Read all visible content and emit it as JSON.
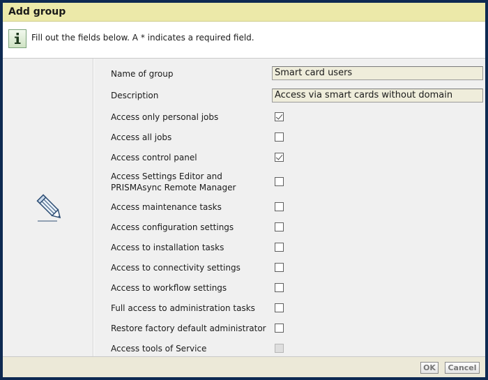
{
  "dialog": {
    "title": "Add group"
  },
  "info": {
    "icon": "info-icon",
    "text": "Fill out the fields below. A * indicates a required field."
  },
  "side": {
    "icon": "pencil-icon"
  },
  "fields": {
    "name": {
      "label": "Name of group",
      "value": "Smart card users"
    },
    "description": {
      "label": "Description",
      "value": "Access via smart cards without domain"
    }
  },
  "permissions": [
    {
      "label": "Access only personal jobs",
      "checked": true,
      "enabled": true
    },
    {
      "label": "Access all jobs",
      "checked": false,
      "enabled": true
    },
    {
      "label": "Access control panel",
      "checked": true,
      "enabled": true
    },
    {
      "label_line1": "Access Settings Editor and",
      "label_line2": "PRISMAsync Remote Manager",
      "checked": false,
      "enabled": true
    },
    {
      "label": "Access maintenance tasks",
      "checked": false,
      "enabled": true
    },
    {
      "label": "Access configuration settings",
      "checked": false,
      "enabled": true
    },
    {
      "label": "Access to installation tasks",
      "checked": false,
      "enabled": true
    },
    {
      "label": "Access to connectivity settings",
      "checked": false,
      "enabled": true
    },
    {
      "label": "Access to workflow settings",
      "checked": false,
      "enabled": true
    },
    {
      "label": "Full access to administration tasks",
      "checked": false,
      "enabled": true
    },
    {
      "label": "Restore factory default administrator",
      "checked": false,
      "enabled": true
    },
    {
      "label": "Access tools of Service",
      "checked": false,
      "enabled": false
    }
  ],
  "footer": {
    "ok_label": "OK",
    "cancel_label": "Cancel"
  }
}
